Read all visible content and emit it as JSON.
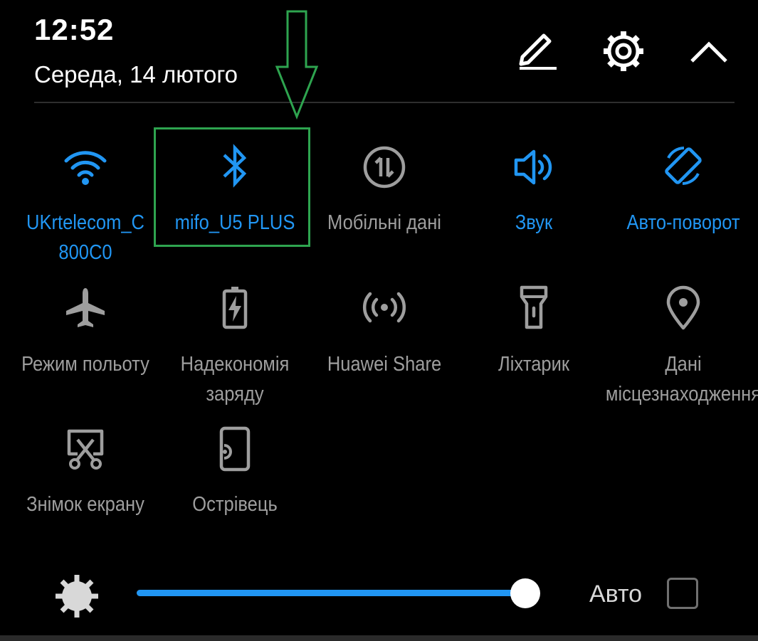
{
  "status": {
    "time": "12:52",
    "date": "Середа, 14 лютого"
  },
  "header_icons": {
    "edit": "pencil-icon",
    "settings": "gear-icon",
    "collapse": "chevron-up-icon"
  },
  "colors": {
    "background": "#000000",
    "active": "#2196f3",
    "inactive": "#9e9e9e",
    "annotation": "#2ea44f"
  },
  "tiles": [
    {
      "label": "UKrtelecom_C 800C0",
      "icon": "wifi-icon",
      "active": true
    },
    {
      "label": "mifo_U5 PLUS",
      "icon": "bluetooth-icon",
      "active": true
    },
    {
      "label": "Мобільні дані",
      "icon": "mobile-data-icon",
      "active": false
    },
    {
      "label": "Звук",
      "icon": "sound-icon",
      "active": true
    },
    {
      "label": "Авто-поворот",
      "icon": "auto-rotate-icon",
      "active": true
    },
    {
      "label": "Режим польоту",
      "icon": "airplane-icon",
      "active": false
    },
    {
      "label": "Надекономія заряду",
      "icon": "battery-saver-icon",
      "active": false
    },
    {
      "label": "Huawei Share",
      "icon": "huawei-share-icon",
      "active": false
    },
    {
      "label": "Ліхтарик",
      "icon": "flashlight-icon",
      "active": false
    },
    {
      "label": "Дані місцезнаходження",
      "icon": "location-icon",
      "active": false
    },
    {
      "label": "Знімок екрану",
      "icon": "screenshot-icon",
      "active": false
    },
    {
      "label": "Острівець",
      "icon": "floating-dock-icon",
      "active": false
    }
  ],
  "brightness": {
    "icon": "brightness-icon",
    "level": 0.99,
    "auto_label": "Авто",
    "auto_checked": false
  }
}
